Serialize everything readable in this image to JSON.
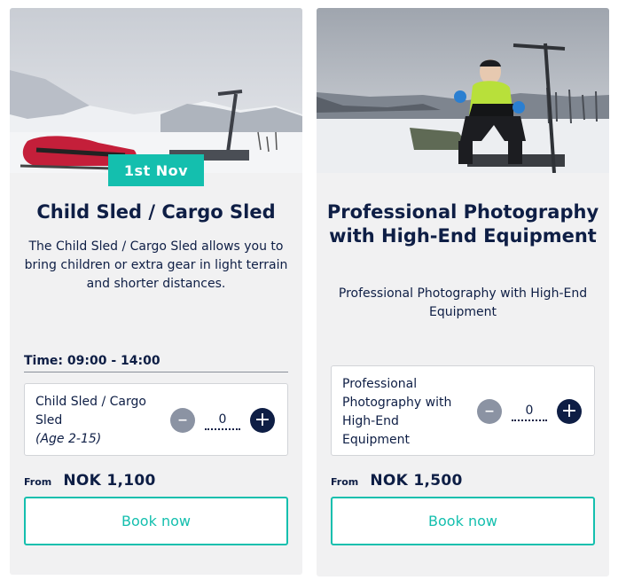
{
  "cards": [
    {
      "date_badge": "1st Nov",
      "title": "Child Sled / Cargo Sled",
      "description": "The Child Sled / Cargo Sled allows you to bring children or extra gear in light terrain and shorter distances.",
      "time": "Time: 09:00 - 14:00",
      "ticket": {
        "name": "Child Sled / Cargo Sled",
        "age": "(Age 2-15)",
        "quantity": "0"
      },
      "price": {
        "from": "From",
        "amount": "NOK 1,100"
      },
      "book_label": "Book now"
    },
    {
      "title": "Professional Photography with High-End Equipment",
      "description": "Professional Photography with High-End Equipment",
      "ticket": {
        "name": "Professional Photography with High-End Equipment",
        "quantity": "0"
      },
      "price": {
        "from": "From",
        "amount": "NOK 1,500"
      },
      "book_label": "Book now"
    }
  ],
  "colors": {
    "accent": "#14bfae",
    "navy": "#0e1e45",
    "card_bg": "#f1f1f2",
    "minus_button": "#8b93a3"
  },
  "icons": [
    "minus-icon",
    "plus-icon"
  ]
}
